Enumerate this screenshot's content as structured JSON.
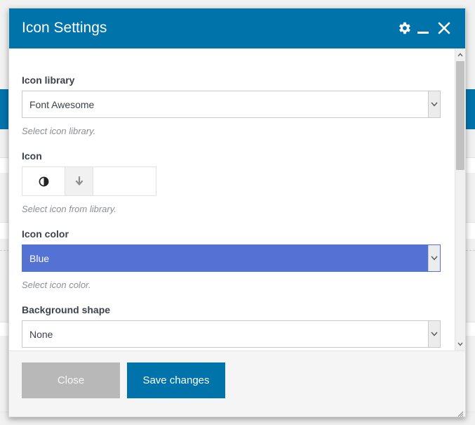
{
  "modal": {
    "title": "Icon Settings",
    "header_icons": [
      "gear-icon",
      "minimize-icon",
      "close-icon"
    ]
  },
  "fields": {
    "icon_library": {
      "label": "Icon library",
      "value": "Font Awesome",
      "helper": "Select icon library."
    },
    "icon": {
      "label": "Icon",
      "preview_icon": "adjust-icon",
      "dropdown_icon": "arrow-down-icon",
      "helper": "Select icon from library."
    },
    "icon_color": {
      "label": "Icon color",
      "value": "Blue",
      "helper": "Select icon color."
    },
    "background_shape": {
      "label": "Background shape",
      "value": "None"
    }
  },
  "footer": {
    "close_label": "Close",
    "save_label": "Save changes"
  },
  "colors": {
    "accent": "#0073aa",
    "icon_color_blue": "#5472d3",
    "close_button": "#b8b8b8"
  }
}
